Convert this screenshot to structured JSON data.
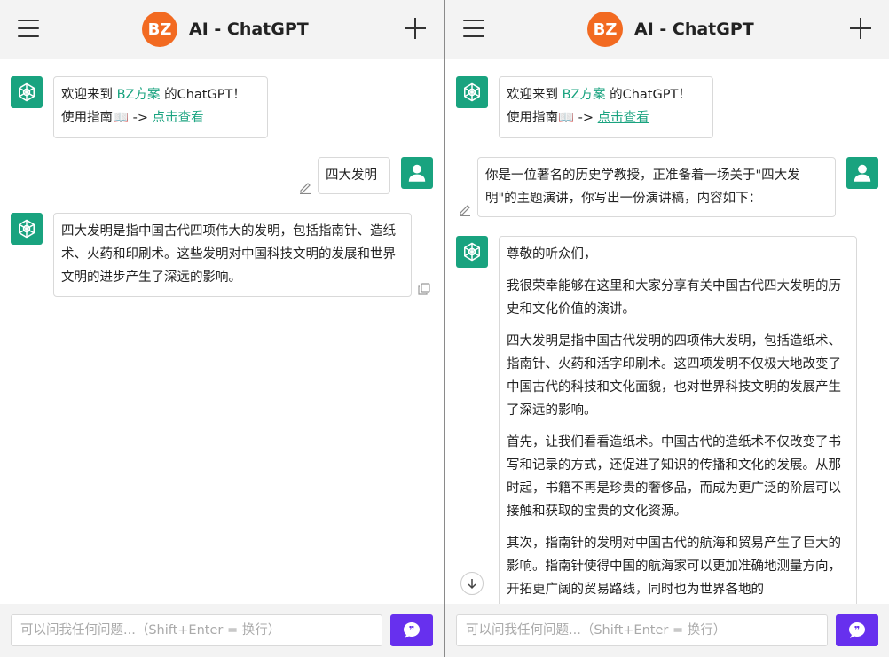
{
  "header": {
    "logo_text": "BZ",
    "title": "AI - ChatGPT"
  },
  "colors": {
    "accent_green": "#19a37f",
    "logo_orange": "#f26a21",
    "send_purple": "#6730ee",
    "header_bg": "#f3f3f3"
  },
  "icons": [
    "menu-icon",
    "plus-icon",
    "openai-logo-icon",
    "user-icon",
    "edit-icon",
    "copy-icon",
    "arrow-down-icon",
    "chat-bubble-icon"
  ],
  "welcome": {
    "line1_prefix": "欢迎来到 ",
    "line1_link": "BZ方案",
    "line1_suffix": " 的ChatGPT！",
    "line2_prefix": "使用指南📖 -> ",
    "line2_link": "点击查看"
  },
  "left": {
    "user_message": "四大发明",
    "assistant_reply": "四大发明是指中国古代四项伟大的发明，包括指南针、造纸术、火药和印刷术。这些发明对中国科技文明的发展和世界文明的进步产生了深远的影响。"
  },
  "right": {
    "user_message": "你是一位著名的历史学教授，正准备着一场关于\"四大发明\"的主题演讲，你写出一份演讲稿，内容如下：",
    "assistant_paragraphs": [
      "尊敬的听众们，",
      "我很荣幸能够在这里和大家分享有关中国古代四大发明的历史和文化价值的演讲。",
      "四大发明是指中国古代发明的四项伟大发明，包括造纸术、指南针、火药和活字印刷术。这四项发明不仅极大地改变了中国古代的科技和文化面貌，也对世界科技文明的发展产生了深远的影响。",
      "首先，让我们看看造纸术。中国古代的造纸术不仅改变了书写和记录的方式，还促进了知识的传播和文化的发展。从那时起，书籍不再是珍贵的奢侈品，而成为更广泛的阶层可以接触和获取的宝贵的文化资源。",
      "其次，指南针的发明对中国古代的航海和贸易产生了巨大的影响。指南针使得中国的航海家可以更加准确地测量方向，开拓更广阔的贸易路线，同时也为世界各地的"
    ]
  },
  "input": {
    "placeholder": "可以问我任何问题...（Shift+Enter = 换行）"
  }
}
